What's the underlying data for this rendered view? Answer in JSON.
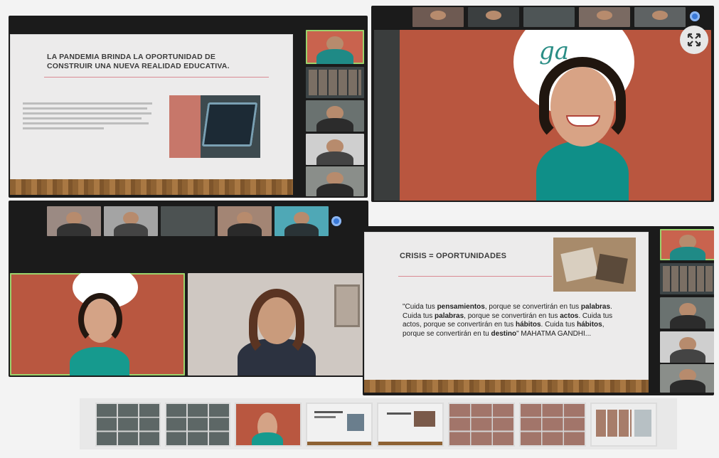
{
  "top_left_slide": {
    "title_line1": "LA PANDEMIA BRINDA LA OPORTUNIDAD DE",
    "title_line2": "CONSTRUIR UNA NUEVA REALIDAD EDUCATIVA."
  },
  "crisis_slide": {
    "title": "CRISIS = OPORTUNIDADES",
    "quote_parts": [
      {
        "text": "\"Cuida tus ",
        "bold": false
      },
      {
        "text": "pensamientos",
        "bold": true
      },
      {
        "text": ", porque se convertirán en tus ",
        "bold": false
      },
      {
        "text": "palabras",
        "bold": true
      },
      {
        "text": ". Cuida tus ",
        "bold": false
      },
      {
        "text": "palabras",
        "bold": true
      },
      {
        "text": ", porque se convertirán en tus ",
        "bold": false
      },
      {
        "text": "actos",
        "bold": true
      },
      {
        "text": ". Cuida tus actos, porque se convertirán en tus ",
        "bold": false
      },
      {
        "text": "hábitos",
        "bold": true
      },
      {
        "text": ". Cuida tus ",
        "bold": false
      },
      {
        "text": "hábitos",
        "bold": true
      },
      {
        "text": ", porque se convertirán en tu ",
        "bold": false
      },
      {
        "text": "destino",
        "bold": true
      },
      {
        "text": "\" MAHATMA GANDHI...",
        "bold": false
      }
    ]
  },
  "colors": {
    "accent_green": "#9bd36c",
    "meeting_blue": "#3a79d8",
    "speaker_teal": "#1f8a86"
  },
  "icons": {
    "fullscreen": "expand-arrows-icon",
    "participants": "blue-participant-dot-icon"
  }
}
